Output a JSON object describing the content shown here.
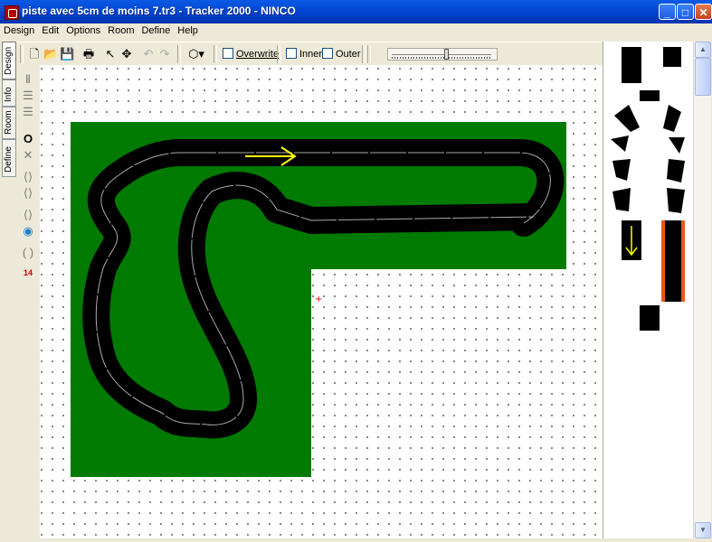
{
  "window": {
    "title": "piste avec 5cm de moins 7.tr3 - Tracker 2000 - NINCO",
    "minimize_glyph": "_",
    "maximize_glyph": "□",
    "close_glyph": "✕"
  },
  "menu": [
    "Design",
    "Edit",
    "Options",
    "Room",
    "Define",
    "Help"
  ],
  "side_tabs": [
    "Design",
    "Info",
    "Room",
    "Define"
  ],
  "toolbar": {
    "new_icon": "new-document-icon",
    "open_icon": "open-folder-icon",
    "save_icon": "save-disk-icon",
    "print_icon": "printer-icon",
    "select_icon": "arrow-pointer-icon",
    "move_icon": "move-cross-icon",
    "undo_icon": "undo-icon",
    "redo_icon": "redo-icon",
    "shape_icon": "hexagon-dropdown-icon",
    "overwrite_label": "Overwrite",
    "overwrite_checked": false,
    "inner_label": "Inner",
    "inner_checked": false,
    "outer_label": "Outer",
    "outer_checked": false
  },
  "tools": [
    "straight-piece-icon",
    "lane-change-icon",
    "double-lane-icon",
    "loop-icon",
    "crossover-icon",
    "chicane-icon",
    "bridge-icon",
    "lap-counter-icon",
    "rotate-icon",
    "number-flag-icon"
  ],
  "tools_number_label": "14",
  "colors": {
    "board_green": "#007a00",
    "track_black": "#000000",
    "lane_line": "#aaaaaa",
    "direction_arrow": "#ffff00",
    "accent_orange": "#e85818",
    "titlebar_blue": "#0040c8"
  }
}
